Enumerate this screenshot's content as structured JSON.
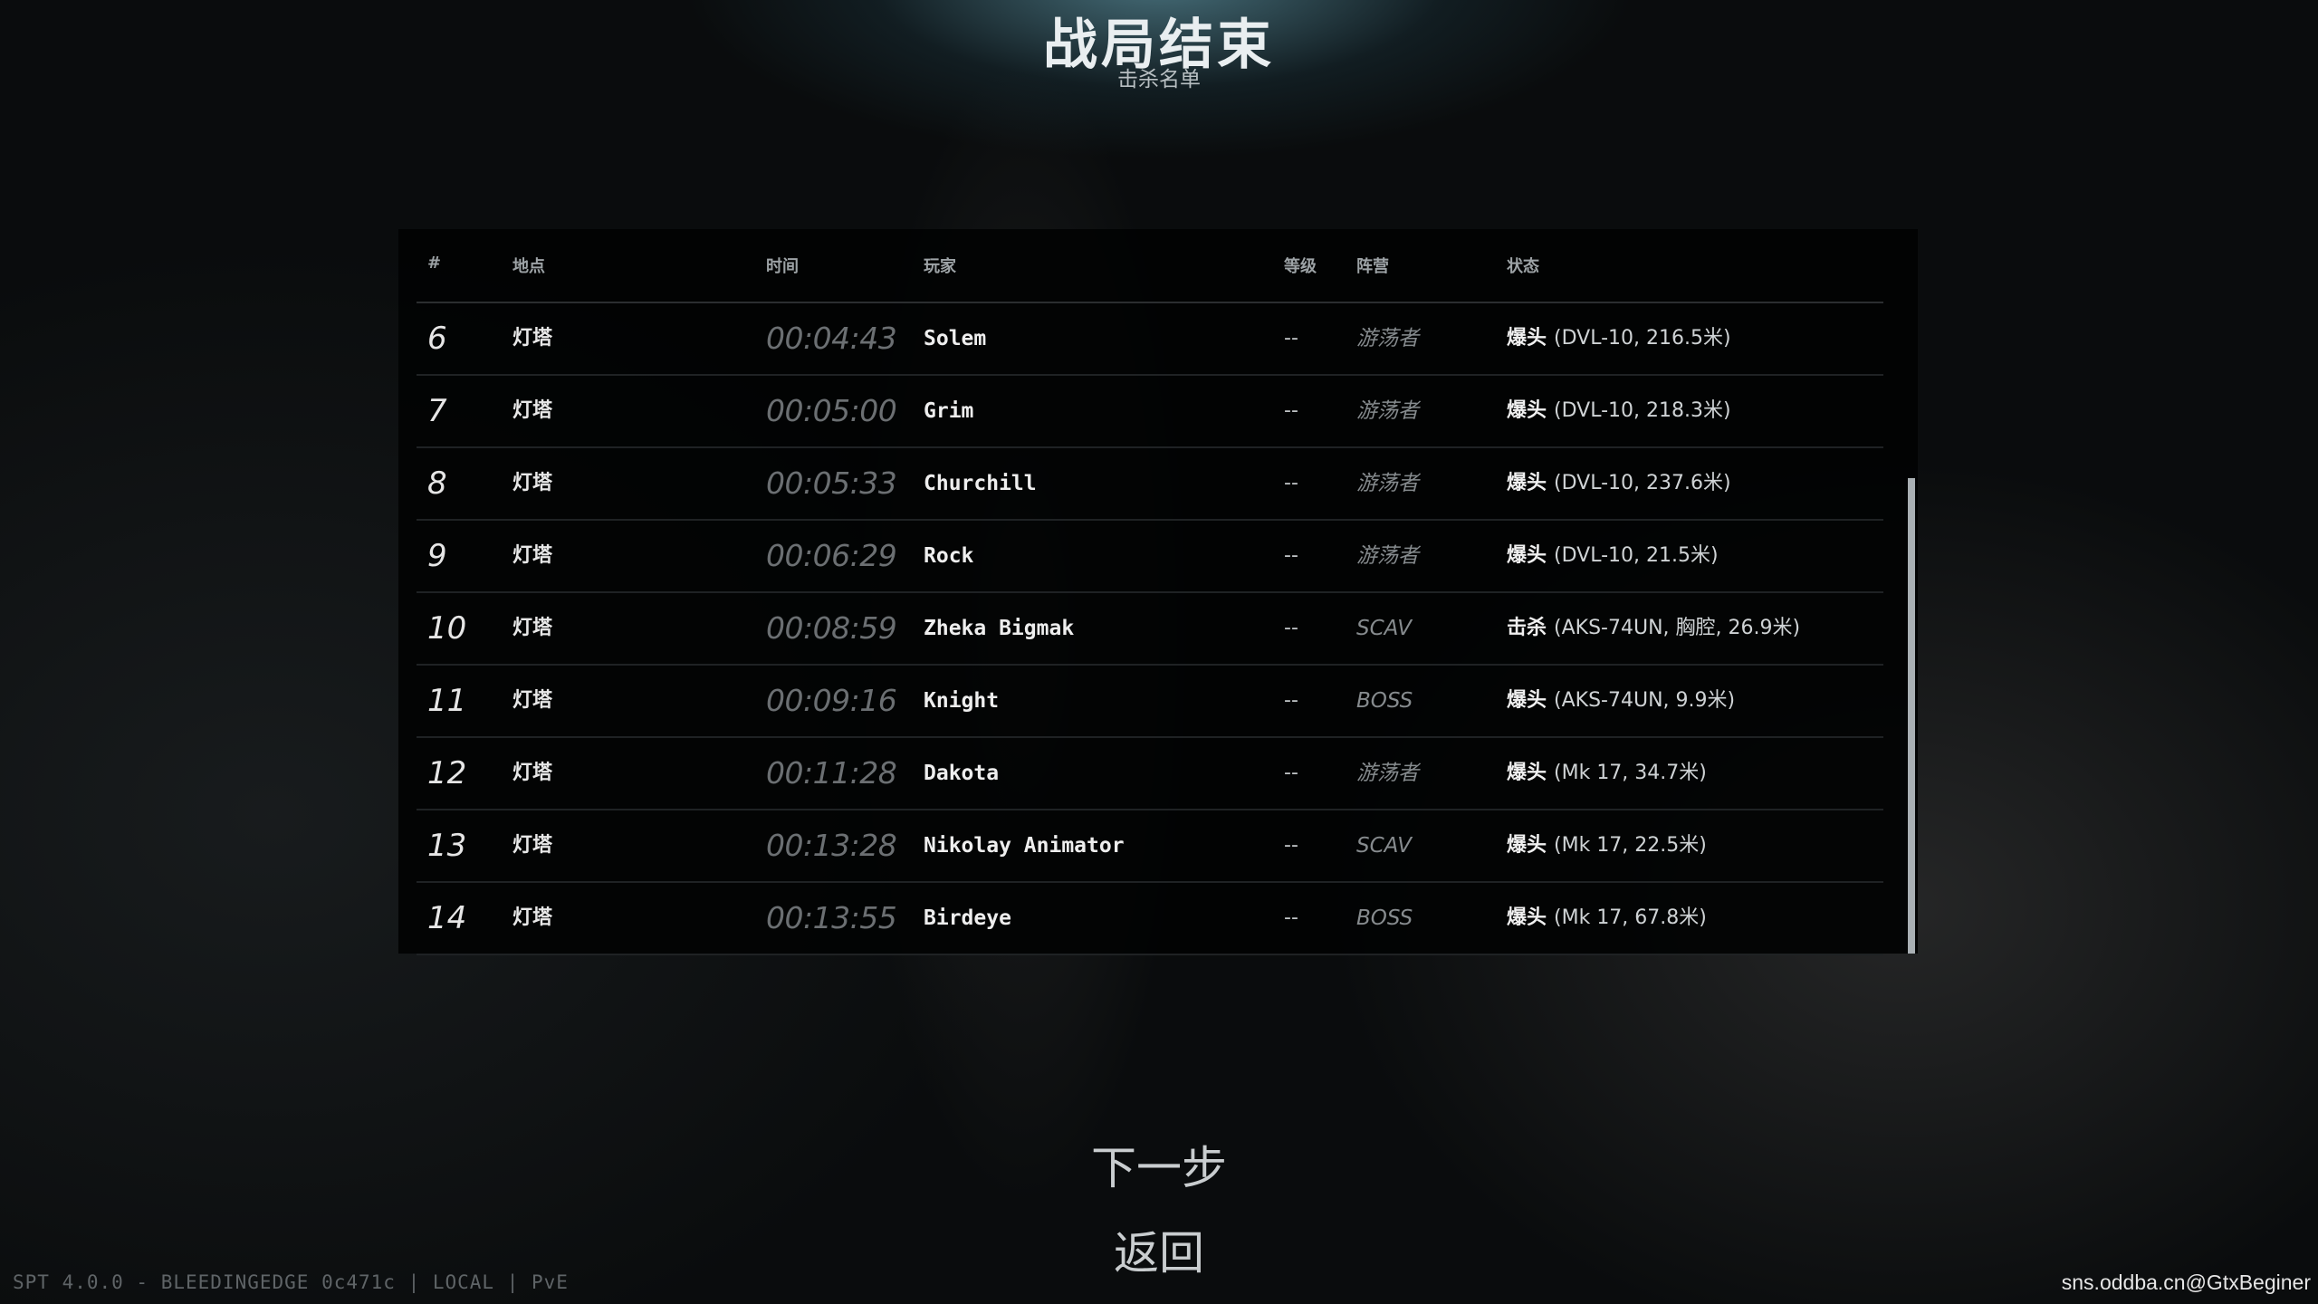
{
  "header": {
    "title": "战局结束",
    "subtitle": "击杀名单"
  },
  "table": {
    "columns": {
      "num": "#",
      "location": "地点",
      "time": "时间",
      "player": "玩家",
      "level": "等级",
      "faction": "阵营",
      "status": "状态"
    },
    "rows": [
      {
        "num": "6",
        "location": "灯塔",
        "time": "00:04:43",
        "player": "Solem",
        "level": "--",
        "faction": "游荡者",
        "status_kind": "爆头",
        "status_detail": "(DVL-10, 216.5米)"
      },
      {
        "num": "7",
        "location": "灯塔",
        "time": "00:05:00",
        "player": "Grim",
        "level": "--",
        "faction": "游荡者",
        "status_kind": "爆头",
        "status_detail": "(DVL-10, 218.3米)"
      },
      {
        "num": "8",
        "location": "灯塔",
        "time": "00:05:33",
        "player": "Churchill",
        "level": "--",
        "faction": "游荡者",
        "status_kind": "爆头",
        "status_detail": "(DVL-10, 237.6米)"
      },
      {
        "num": "9",
        "location": "灯塔",
        "time": "00:06:29",
        "player": "Rock",
        "level": "--",
        "faction": "游荡者",
        "status_kind": "爆头",
        "status_detail": "(DVL-10, 21.5米)"
      },
      {
        "num": "10",
        "location": "灯塔",
        "time": "00:08:59",
        "player": "Zheka Bigmak",
        "level": "--",
        "faction": "SCAV",
        "status_kind": "击杀",
        "status_detail": "(AKS-74UN, 胸腔, 26.9米)"
      },
      {
        "num": "11",
        "location": "灯塔",
        "time": "00:09:16",
        "player": "Knight",
        "level": "--",
        "faction": "BOSS",
        "status_kind": "爆头",
        "status_detail": "(AKS-74UN, 9.9米)"
      },
      {
        "num": "12",
        "location": "灯塔",
        "time": "00:11:28",
        "player": "Dakota",
        "level": "--",
        "faction": "游荡者",
        "status_kind": "爆头",
        "status_detail": "(Mk 17, 34.7米)"
      },
      {
        "num": "13",
        "location": "灯塔",
        "time": "00:13:28",
        "player": "Nikolay Animator",
        "level": "--",
        "faction": "SCAV",
        "status_kind": "爆头",
        "status_detail": "(Mk 17, 22.5米)"
      },
      {
        "num": "14",
        "location": "灯塔",
        "time": "00:13:55",
        "player": "Birdeye",
        "level": "--",
        "faction": "BOSS",
        "status_kind": "爆头",
        "status_detail": "(Mk 17, 67.8米)"
      }
    ]
  },
  "buttons": {
    "next": "下一步",
    "back": "返回"
  },
  "footer": {
    "version": "SPT 4.0.0 - BLEEDINGEDGE 0c471c | LOCAL | PvE",
    "watermark": "sns.oddba.cn@GtxBeginer"
  },
  "colors": {
    "panel_bg": "#020303",
    "scrollbar_thumb": "#a9b0b4",
    "time_text": "#6b6f72"
  }
}
